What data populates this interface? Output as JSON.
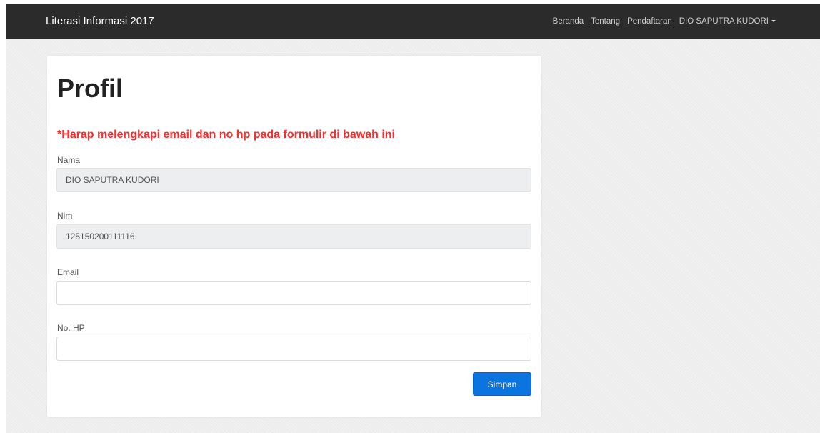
{
  "navbar": {
    "brand": "Literasi Informasi 2017",
    "links": [
      "Beranda",
      "Tentang",
      "Pendaftaran"
    ],
    "user_menu": "DIO SAPUTRA KUDORI"
  },
  "profile": {
    "title": "Profil",
    "notice": "*Harap melengkapi email dan no hp pada formulir di bawah ini",
    "fields": [
      {
        "label": "Nama",
        "value": "DIO SAPUTRA KUDORI",
        "placeholder": ""
      },
      {
        "label": "Nim",
        "value": "125150200111116",
        "placeholder": ""
      },
      {
        "label": "Email",
        "value": "",
        "placeholder": ""
      },
      {
        "label": "No. HP",
        "value": "",
        "placeholder": ""
      }
    ],
    "submit_label": "Simpan"
  },
  "colors": {
    "navbar_bg": "#2b2b2b",
    "notice": "#ff2a2a",
    "button": "#0b74de",
    "readonly_field_bg": "#eceeef"
  }
}
